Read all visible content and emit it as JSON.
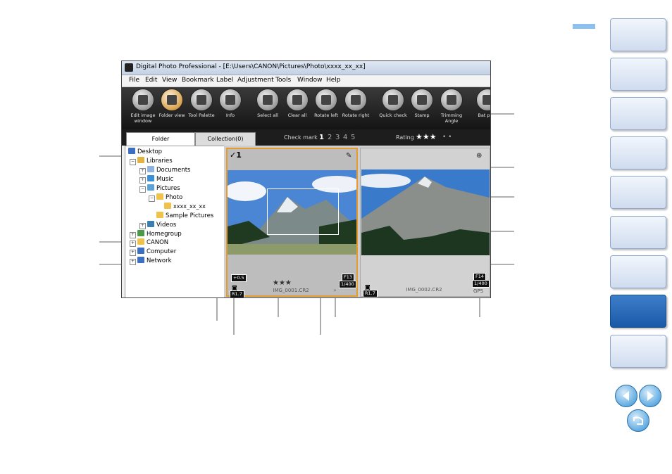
{
  "window": {
    "title": "Digital Photo Professional - [E:\\Users\\CANON\\Pictures\\Photo\\xxxx_xx_xx]",
    "menu": [
      "File",
      "Edit",
      "View",
      "Bookmark",
      "Label",
      "Adjustment",
      "Tools",
      "Window",
      "Help"
    ]
  },
  "toolbar": {
    "buttons": [
      {
        "label": "Edit image window",
        "icon": "edit-image-icon"
      },
      {
        "label": "Folder view",
        "icon": "folder-view-icon"
      },
      {
        "label": "Tool Palette",
        "icon": "tool-palette-icon"
      },
      {
        "label": "Info",
        "icon": "info-icon"
      },
      {
        "label": "Select all",
        "icon": "select-all-icon"
      },
      {
        "label": "Clear all",
        "icon": "clear-all-icon"
      },
      {
        "label": "Rotate left",
        "icon": "rotate-left-icon"
      },
      {
        "label": "Rotate right",
        "icon": "rotate-right-icon"
      },
      {
        "label": "Quick check",
        "icon": "quick-check-icon"
      },
      {
        "label": "Stamp",
        "icon": "stamp-icon"
      },
      {
        "label": "Trimming Angle",
        "icon": "trimming-angle-icon"
      },
      {
        "label": "Bat proc",
        "icon": "batch-process-icon"
      }
    ]
  },
  "tabs": {
    "folder": "Folder",
    "collection": "Collection(0)"
  },
  "checkbar": {
    "check_label": "Check mark",
    "numbers": [
      "1",
      "2",
      "3",
      "4",
      "5"
    ],
    "rating_label": "Rating",
    "stars": "★★★",
    "dots": "• •"
  },
  "tree": {
    "items": [
      {
        "label": "Desktop",
        "color": "#3b6fc4"
      },
      {
        "label": "Libraries",
        "color": "#e3b341"
      },
      {
        "label": "Documents",
        "color": "#8fb3e0"
      },
      {
        "label": "Music",
        "color": "#3a8fd6"
      },
      {
        "label": "Pictures",
        "color": "#5aa3d8"
      },
      {
        "label": "Photo",
        "color": "#f0c24a"
      },
      {
        "label": "xxxx_xx_xx",
        "color": "#f0c24a"
      },
      {
        "label": "Sample Pictures",
        "color": "#f0c24a"
      },
      {
        "label": "Videos",
        "color": "#3a7fb0"
      },
      {
        "label": "Homegroup",
        "color": "#4a9a4a"
      },
      {
        "label": "CANON",
        "color": "#f0c24a"
      },
      {
        "label": "Computer",
        "color": "#3b6fc4"
      },
      {
        "label": "Network",
        "color": "#3b6fc4"
      }
    ]
  },
  "thumbs": [
    {
      "check": "✓1",
      "stars": "★★★",
      "exposure": "+0.5",
      "aperture": "F13",
      "shutter": "1/400",
      "filename": "IMG_0001.CR2",
      "camera_badge": "R1.7",
      "extra": "»"
    },
    {
      "aperture": "F14",
      "shutter": "1/400",
      "filename": "IMG_0002.CR2",
      "camera_badge": "R1.7",
      "gps": "GPS"
    }
  ],
  "colors": {
    "accent_orange": "#e79a2e",
    "sidebar_selected": "#1a59a8",
    "nav_blue": "#5aa8e0"
  }
}
